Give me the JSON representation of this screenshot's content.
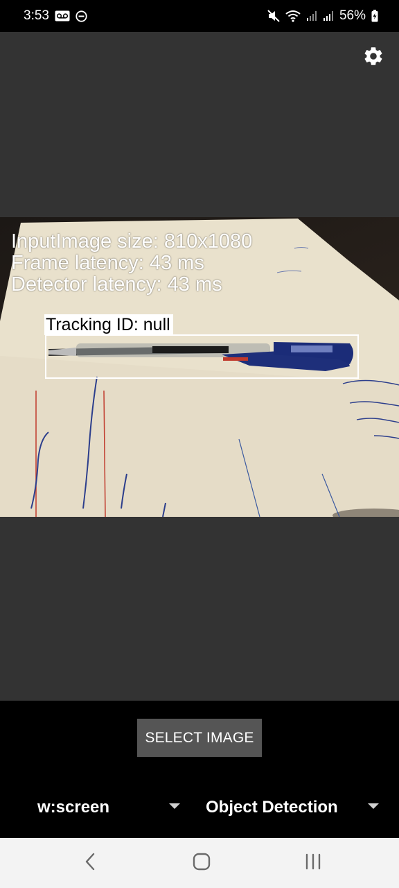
{
  "status_bar": {
    "time": "3:53",
    "battery_percent": "56%",
    "icons_left": [
      "voicemail-icon",
      "do-not-disturb-icon"
    ],
    "icons_right": [
      "mute-icon",
      "wifi-icon",
      "signal-icon",
      "signal-icon",
      "battery-charging-icon"
    ]
  },
  "app": {
    "settings_icon": "gear-icon",
    "overlay": {
      "input_image_size": "InputImage size: 810x1080",
      "frame_latency": "Frame latency: 43 ms",
      "detector_latency": "Detector latency: 43 ms",
      "tracking_label": "Tracking ID: null"
    },
    "detection_color": "#ffffff"
  },
  "controls": {
    "select_image_label": "SELECT IMAGE",
    "size_spinner": {
      "selected": "w:screen"
    },
    "feature_spinner": {
      "selected": "Object Detection"
    }
  },
  "nav_bar": {
    "back_icon": "back-icon",
    "home_icon": "home-icon",
    "recents_icon": "recents-icon"
  },
  "colors": {
    "app_background": "#333333",
    "button_background": "#555555",
    "controls_background": "#000000",
    "nav_background": "#f3f3f3"
  }
}
